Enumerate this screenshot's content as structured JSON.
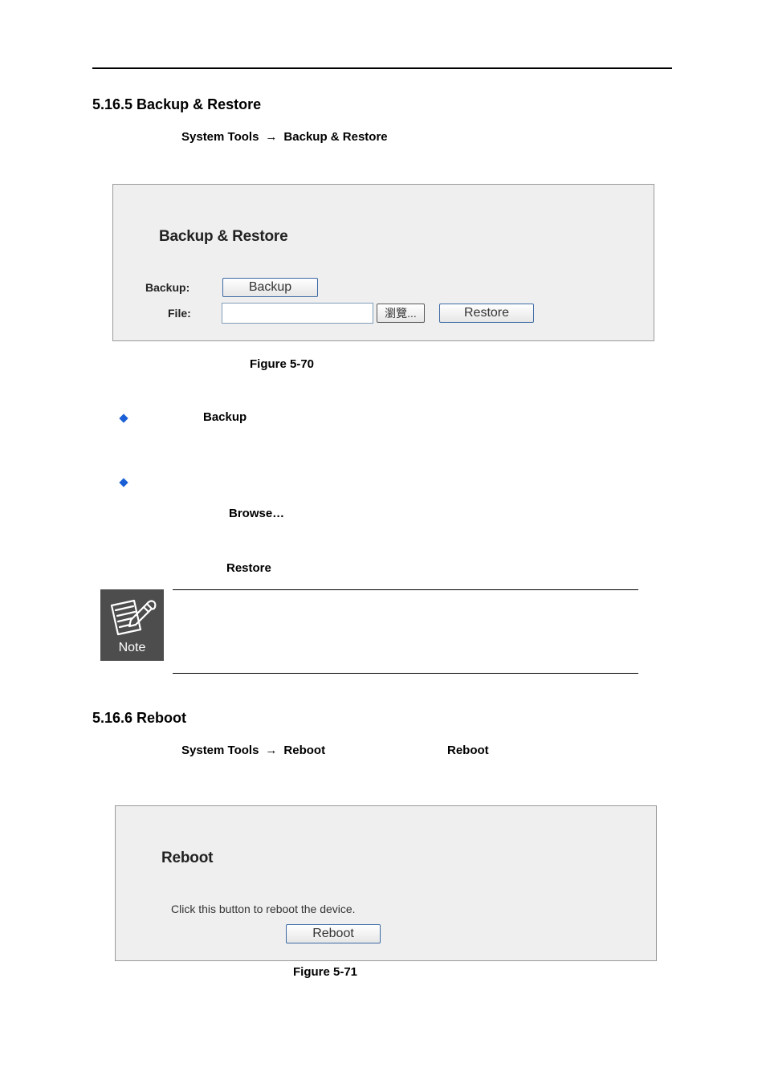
{
  "section1": {
    "heading": "5.16.5 Backup & Restore",
    "nav_a": "System Tools",
    "nav_arrow": "→",
    "nav_b": "Backup & Restore"
  },
  "panel1": {
    "title": "Backup & Restore",
    "backup_label": "Backup:",
    "backup_button": "Backup",
    "file_label": "File:",
    "file_value": "",
    "browse_button": "瀏覽...",
    "restore_button": "Restore"
  },
  "figure1": "Figure 5-70",
  "bullets": {
    "backup_term": "Backup",
    "browse_term": "Browse…",
    "restore_term": "Restore"
  },
  "note": {
    "label": "Note"
  },
  "section2": {
    "heading": "5.16.6 Reboot",
    "nav_a": "System Tools",
    "nav_arrow": "→",
    "nav_b": "Reboot",
    "nav_c": "Reboot"
  },
  "panel2": {
    "title": "Reboot",
    "instruction": "Click this button to reboot the device.",
    "reboot_button": "Reboot"
  },
  "figure2": "Figure 5-71",
  "colors": {
    "panel_bg": "#efefef",
    "bullet": "#1a5fd6",
    "note_bg": "#4d4d4d",
    "button_border": "#3c6aa5"
  }
}
